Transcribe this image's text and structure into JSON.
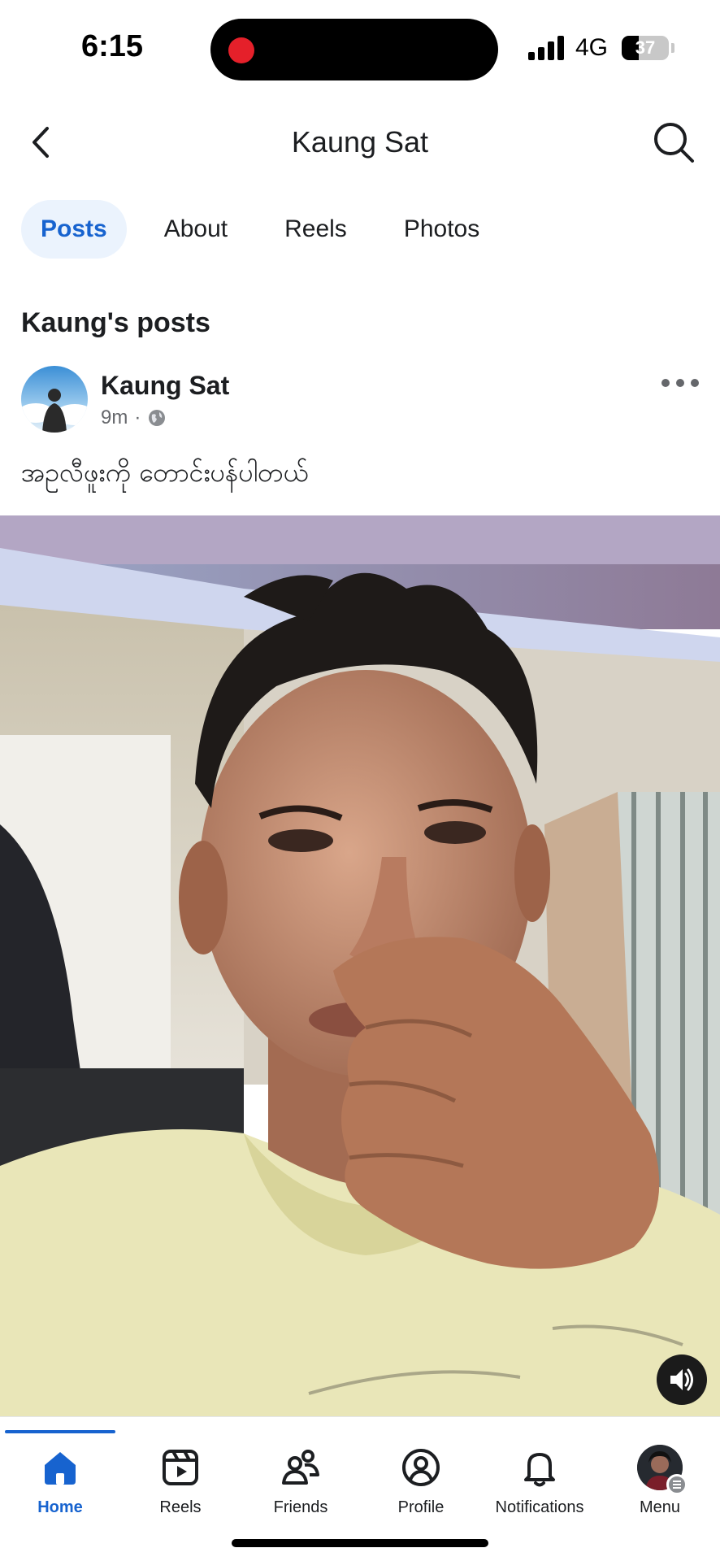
{
  "status_bar": {
    "time": "6:15",
    "network": "4G",
    "battery_level": "37",
    "battery_fraction": 0.37,
    "recording_color": "#e5202a"
  },
  "header": {
    "title": "Kaung Sat",
    "back_icon": "chevron-left-icon",
    "search_icon": "search-icon"
  },
  "tabs": [
    {
      "label": "Posts",
      "active": true
    },
    {
      "label": "About",
      "active": false
    },
    {
      "label": "Reels",
      "active": false
    },
    {
      "label": "Photos",
      "active": false
    }
  ],
  "section_title": "Kaung's posts",
  "post": {
    "author": "Kaung Sat",
    "time": "9m",
    "separator": "·",
    "privacy_icon": "globe-icon",
    "text": "အဥလီဖူးကို တောင်းပန်ပါတယ်",
    "media_type": "video",
    "sound_icon": "speaker-on-icon"
  },
  "bottom_nav": {
    "items": [
      {
        "label": "Home",
        "icon": "home-icon",
        "active": true
      },
      {
        "label": "Reels",
        "icon": "reels-icon",
        "active": false
      },
      {
        "label": "Friends",
        "icon": "friends-icon",
        "active": false
      },
      {
        "label": "Profile",
        "icon": "profile-icon",
        "active": false
      },
      {
        "label": "Notifications",
        "icon": "bell-icon",
        "active": false
      },
      {
        "label": "Menu",
        "icon": "menu-avatar-icon",
        "active": false
      }
    ]
  },
  "colors": {
    "accent": "#1763cf",
    "active_tab_bg": "#ebf3fd",
    "secondary_text": "#65676b"
  }
}
